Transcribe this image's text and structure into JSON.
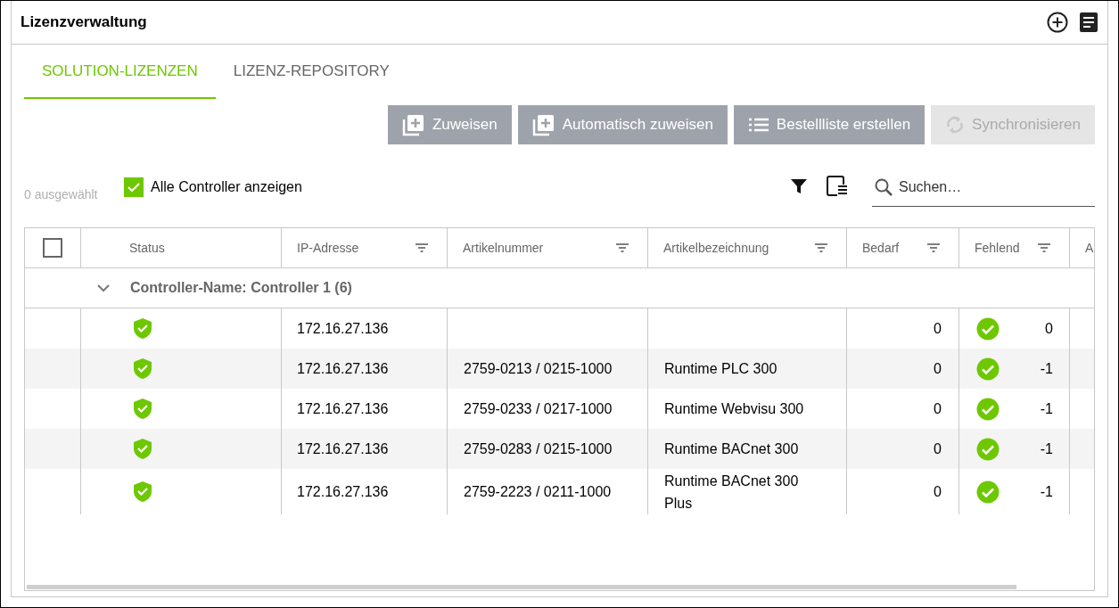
{
  "window": {
    "title": "Lizenzverwaltung"
  },
  "tabs": [
    {
      "label": "SOLUTION-LIZENZEN",
      "selected": true
    },
    {
      "label": "LIZENZ-REPOSITORY",
      "selected": false
    }
  ],
  "buttons": [
    {
      "label": "Zuweisen",
      "kind": "add",
      "disabled": false
    },
    {
      "label": "Automatisch zuweisen",
      "kind": "add",
      "disabled": false
    },
    {
      "label": "Bestellliste erstellen",
      "kind": "list",
      "disabled": false
    },
    {
      "label": "Synchronisieren",
      "kind": "sync",
      "disabled": true
    }
  ],
  "selection_count": "0 ausgewählt",
  "show_all_controllers": {
    "label": "Alle Controller anzeigen",
    "checked": true
  },
  "search": {
    "placeholder": "Suchen…"
  },
  "table": {
    "select_all": {
      "checked": false
    },
    "columns": [
      {
        "label": "Status",
        "filter": false
      },
      {
        "label": "IP-Adresse",
        "filter": true
      },
      {
        "label": "Artikelnummer",
        "filter": true
      },
      {
        "label": "Artikelbezeichnung",
        "filter": true
      },
      {
        "label": "Bedarf",
        "filter": true
      },
      {
        "label": "Fehlend",
        "filter": true
      },
      {
        "label": "A",
        "filter": false
      }
    ],
    "group": {
      "label": "Controller-Name: Controller 1 (6)",
      "expanded": true
    },
    "rows": [
      {
        "ip": "172.16.27.136",
        "article_number": "",
        "article_name": "",
        "demand": "0",
        "missing": "0"
      },
      {
        "ip": "172.16.27.136",
        "article_number": "2759-0213 / 0215-1000",
        "article_name": "Runtime PLC 300",
        "demand": "0",
        "missing": "-1"
      },
      {
        "ip": "172.16.27.136",
        "article_number": "2759-0233 / 0217-1000",
        "article_name": "Runtime Webvisu 300",
        "demand": "0",
        "missing": "-1"
      },
      {
        "ip": "172.16.27.136",
        "article_number": "2759-0283 / 0215-1000",
        "article_name": "Runtime BACnet 300",
        "demand": "0",
        "missing": "-1"
      },
      {
        "ip": "172.16.27.136",
        "article_number": "2759-2223 / 0211-1000",
        "article_name": "Runtime BACnet 300 Plus",
        "demand": "0",
        "missing": "-1"
      }
    ]
  }
}
